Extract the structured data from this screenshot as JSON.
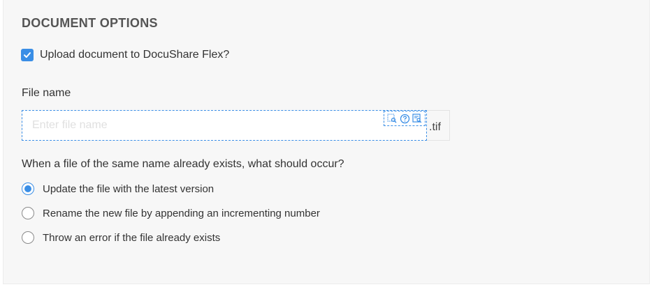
{
  "section": {
    "title": "DOCUMENT OPTIONS"
  },
  "upload": {
    "label": "Upload document to DocuShare Flex?",
    "checked": true
  },
  "file_name": {
    "label": "File name",
    "placeholder": "Enter file name",
    "value": "",
    "extension": ".tif",
    "tray_icons": [
      "zoom-region-icon",
      "help-icon",
      "preview-icon"
    ]
  },
  "conflict": {
    "question": "When a file of the same name already exists, what should occur?",
    "options": [
      {
        "label": "Update the file with the latest version",
        "selected": true
      },
      {
        "label": "Rename the new file by appending an incrementing number",
        "selected": false
      },
      {
        "label": "Throw an error if the file already exists",
        "selected": false
      }
    ]
  },
  "colors": {
    "accent": "#3a8ee6",
    "panel_bg": "#f7f7f7",
    "title_text": "#555555"
  }
}
